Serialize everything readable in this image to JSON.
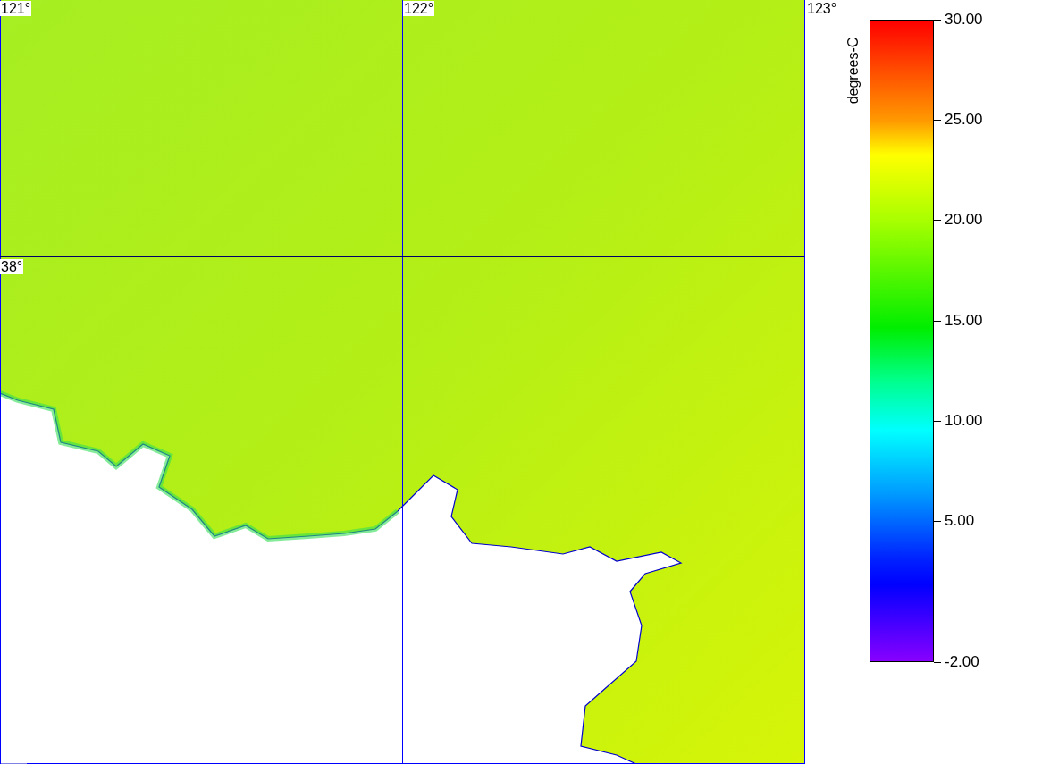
{
  "map": {
    "lon_labels": [
      "121°",
      "122°",
      "123°"
    ],
    "lat_labels": [
      "38°"
    ]
  },
  "colorbar": {
    "units": "degrees-C",
    "ticks": [
      "30.00",
      "25.00",
      "20.00",
      "15.00",
      "10.00",
      "5.00",
      "-2.00"
    ]
  }
}
